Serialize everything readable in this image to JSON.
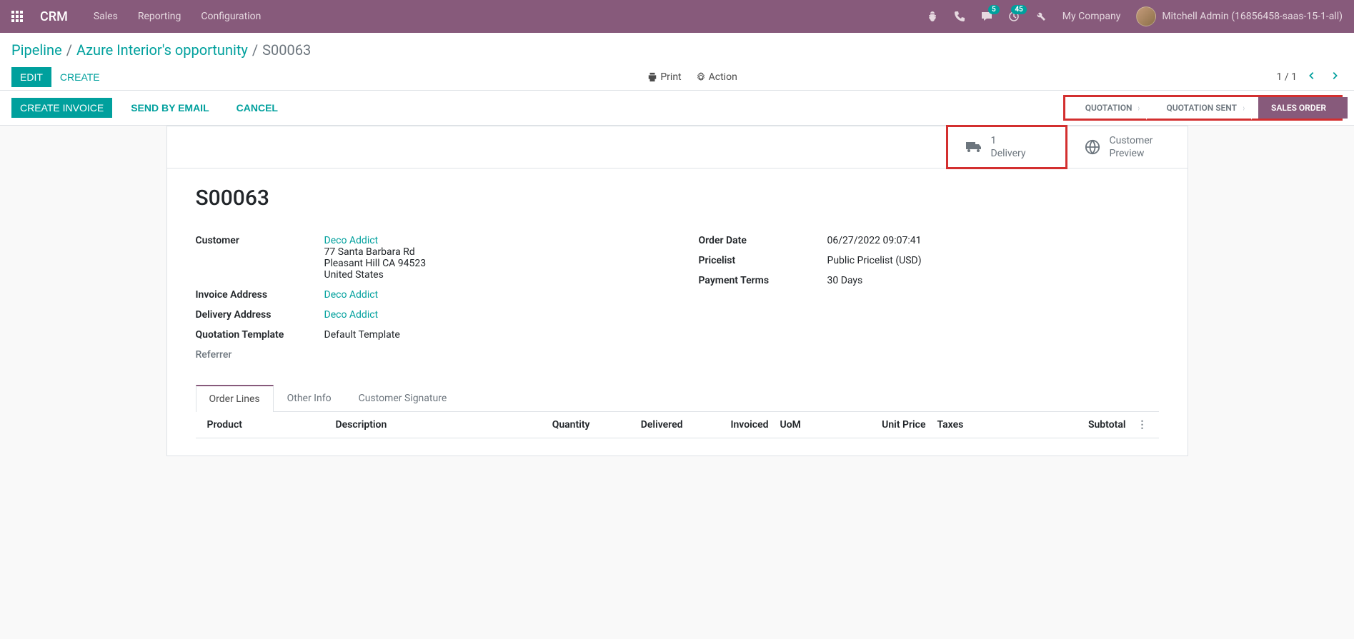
{
  "navbar": {
    "brand": "CRM",
    "menu": [
      "Sales",
      "Reporting",
      "Configuration"
    ],
    "badges": {
      "messages": "5",
      "activities": "45"
    },
    "company": "My Company",
    "user": "Mitchell Admin (16856458-saas-15-1-all)"
  },
  "breadcrumb": {
    "items": [
      "Pipeline",
      "Azure Interior's opportunity"
    ],
    "current": "S00063"
  },
  "buttons": {
    "edit": "EDIT",
    "create": "CREATE",
    "print": "Print",
    "action": "Action",
    "create_invoice": "CREATE INVOICE",
    "send_email": "SEND BY EMAIL",
    "cancel": "CANCEL"
  },
  "pager": {
    "text": "1 / 1"
  },
  "stages": {
    "quotation": "QUOTATION",
    "quotation_sent": "QUOTATION SENT",
    "sales_order": "SALES ORDER"
  },
  "stat_buttons": {
    "delivery": {
      "count": "1",
      "label": "Delivery"
    },
    "preview": {
      "line1": "Customer",
      "line2": "Preview"
    }
  },
  "doc_title": "S00063",
  "fields": {
    "customer_label": "Customer",
    "customer_name": "Deco Addict",
    "customer_addr1": "77 Santa Barbara Rd",
    "customer_addr2": "Pleasant Hill CA 94523",
    "customer_addr3": "United States",
    "invoice_addr_label": "Invoice Address",
    "invoice_addr_value": "Deco Addict",
    "delivery_addr_label": "Delivery Address",
    "delivery_addr_value": "Deco Addict",
    "quote_tmpl_label": "Quotation Template",
    "quote_tmpl_value": "Default Template",
    "referrer_label": "Referrer",
    "order_date_label": "Order Date",
    "order_date_value": "06/27/2022 09:07:41",
    "pricelist_label": "Pricelist",
    "pricelist_value": "Public Pricelist (USD)",
    "payment_terms_label": "Payment Terms",
    "payment_terms_value": "30 Days"
  },
  "tabs": {
    "order_lines": "Order Lines",
    "other_info": "Other Info",
    "signature": "Customer Signature"
  },
  "table": {
    "product": "Product",
    "description": "Description",
    "quantity": "Quantity",
    "delivered": "Delivered",
    "invoiced": "Invoiced",
    "uom": "UoM",
    "unit_price": "Unit Price",
    "taxes": "Taxes",
    "subtotal": "Subtotal"
  }
}
